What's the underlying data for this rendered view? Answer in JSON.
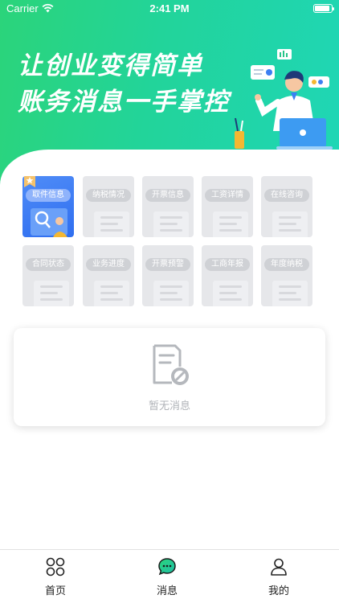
{
  "status_bar": {
    "carrier": "Carrier",
    "time": "2:41 PM",
    "battery_level": 0.9
  },
  "banner": {
    "headline_line1": "让创业变得简单",
    "headline_line2": "账务消息一手掌控",
    "gradient_start": "#2bd47a",
    "gradient_end": "#1fd6b6"
  },
  "services": [
    {
      "label": "取件信息",
      "active": true
    },
    {
      "label": "纳税情况",
      "active": false
    },
    {
      "label": "开票信息",
      "active": false
    },
    {
      "label": "工资详情",
      "active": false
    },
    {
      "label": "在线咨询",
      "active": false
    },
    {
      "label": "合同状态",
      "active": false
    },
    {
      "label": "业务进度",
      "active": false
    },
    {
      "label": "开票预警",
      "active": false
    },
    {
      "label": "工商年报",
      "active": false
    },
    {
      "label": "年度纳税",
      "active": false
    }
  ],
  "empty_state": {
    "text": "暂无消息",
    "icon": "no-message-document-icon"
  },
  "tabbar": {
    "items": [
      {
        "label": "首页",
        "icon": "grid-home-icon"
      },
      {
        "label": "消息",
        "icon": "chat-bubble-icon"
      },
      {
        "label": "我的",
        "icon": "user-profile-icon"
      }
    ],
    "active_index": 1,
    "accent_color": "#22c98c"
  }
}
